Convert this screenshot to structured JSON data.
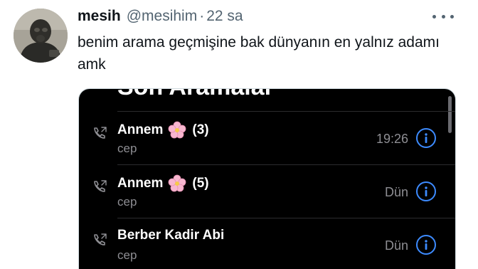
{
  "tweet": {
    "display_name": "mesih",
    "handle": "@mesihim",
    "separator": "·",
    "time": "22 sa",
    "text": "benim arama geçmişine bak dünyanın en yalnız adamı amk"
  },
  "media": {
    "title": "Son Aramalar",
    "calls": [
      {
        "name": "Annem",
        "emoji": "cherry-blossom",
        "count": "(3)",
        "type": "cep",
        "time": "19:26"
      },
      {
        "name": "Annem",
        "emoji": "cherry-blossom",
        "count": "(5)",
        "type": "cep",
        "time": "Dün"
      },
      {
        "name": "Berber Kadir Abi",
        "emoji": "",
        "count": "",
        "type": "cep",
        "time": "Dün"
      }
    ]
  },
  "colors": {
    "handle": "#536471",
    "text": "#0f1419",
    "call_list_bg": "#000000",
    "info_accent": "#3d8bff",
    "secondary_text": "#8e8e93"
  },
  "icons": [
    "avatar-image",
    "more-icon",
    "phone-icon",
    "cherry-blossom-icon",
    "info-icon"
  ]
}
